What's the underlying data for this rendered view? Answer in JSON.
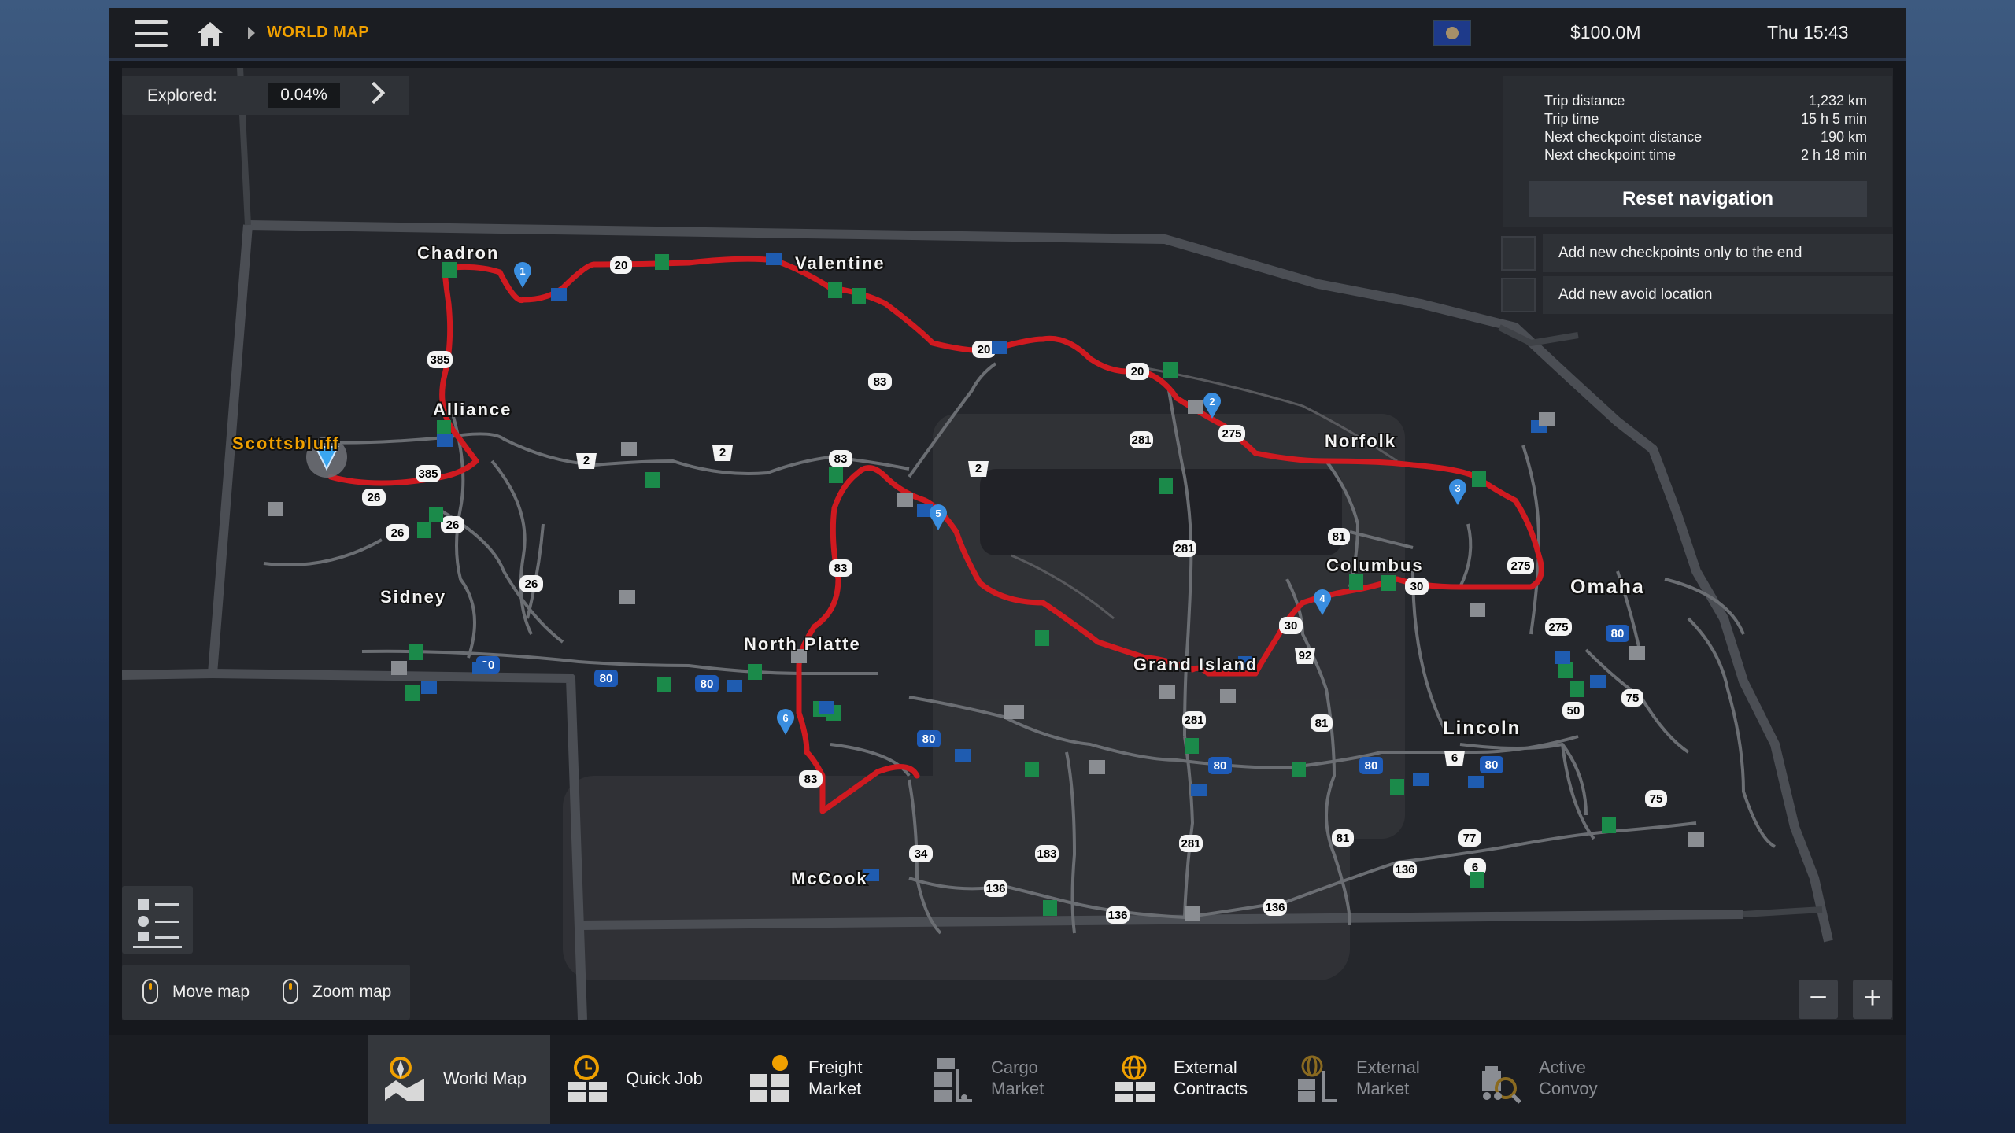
{
  "topbar": {
    "breadcrumb": "WORLD MAP",
    "money": "$100.0M",
    "clock": "Thu 15:43"
  },
  "explored": {
    "label": "Explored:",
    "value": "0.04%"
  },
  "trip": {
    "rows": [
      {
        "key": "Trip distance",
        "value": "1,232 km"
      },
      {
        "key": "Trip time",
        "value": "15 h 5 min"
      },
      {
        "key": "Next checkpoint distance",
        "value": "190 km"
      },
      {
        "key": "Next checkpoint time",
        "value": "2 h 18 min"
      }
    ],
    "reset_label": "Reset navigation"
  },
  "options": [
    {
      "label": "Add new checkpoints only to the end"
    },
    {
      "label": "Add new avoid location"
    }
  ],
  "hints": {
    "move": "Move map",
    "zoom": "Zoom map"
  },
  "zoom": {
    "minus": "−",
    "plus": "+"
  },
  "cities": [
    {
      "name": "Chadron"
    },
    {
      "name": "Valentine"
    },
    {
      "name": "Alliance"
    },
    {
      "name": "Scottsbluff"
    },
    {
      "name": "Norfolk"
    },
    {
      "name": "Columbus"
    },
    {
      "name": "Omaha"
    },
    {
      "name": "Sidney"
    },
    {
      "name": "North Platte"
    },
    {
      "name": "Grand Island"
    },
    {
      "name": "Lincoln"
    },
    {
      "name": "McCook"
    }
  ],
  "road_shields": [
    "20",
    "20",
    "20",
    "385",
    "83",
    "281",
    "275",
    "2",
    "2",
    "83",
    "385",
    "26",
    "26",
    "26",
    "26",
    "2",
    "83",
    "281",
    "81",
    "30",
    "30",
    "275",
    "275",
    "80",
    "80",
    "80",
    "80",
    "80",
    "80",
    "80",
    "80",
    "281",
    "92",
    "81",
    "81",
    "6",
    "77",
    "136",
    "136",
    "136",
    "136",
    "183",
    "34",
    "83",
    "281",
    "75",
    "75",
    "50",
    "6"
  ],
  "checkpoints": [
    "1",
    "2",
    "3",
    "4",
    "5",
    "6"
  ],
  "nav_tabs": [
    {
      "label": "World Map",
      "icon": "map-icon",
      "active": true
    },
    {
      "label": "Quick Job",
      "icon": "clock-icon"
    },
    {
      "label": "Freight Market",
      "icon": "freight-icon"
    },
    {
      "label": "Cargo Market",
      "icon": "cargo-icon",
      "dim": true
    },
    {
      "label": "External Contracts",
      "icon": "globe-icon"
    },
    {
      "label": "External Market",
      "icon": "globe-icon",
      "dim": true
    },
    {
      "label": "Active Convoy",
      "icon": "convoy-icon",
      "dim": true
    }
  ],
  "colors": {
    "accent": "#f0a000",
    "route": "#d01a20",
    "panel": "#2a2d32"
  }
}
